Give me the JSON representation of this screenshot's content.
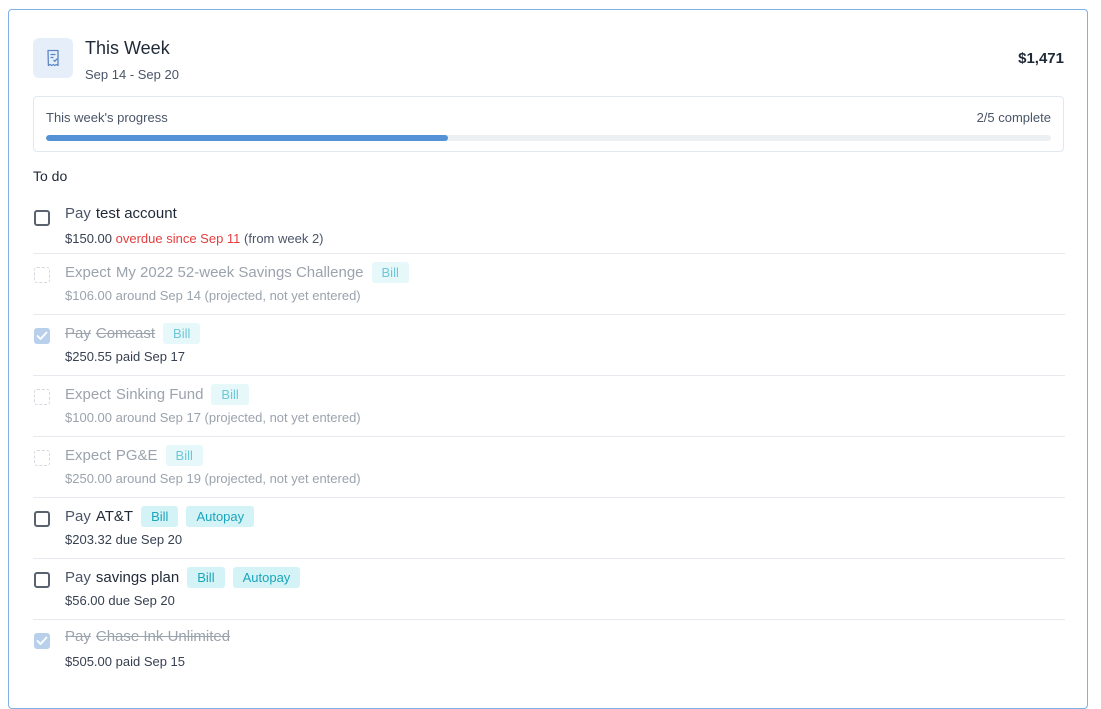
{
  "header": {
    "title": "This Week",
    "date_range": "Sep 14 - Sep 20",
    "total": "$1,471",
    "icon": "receipt-icon"
  },
  "progress": {
    "label": "This week's progress",
    "count_text": "2/5 complete",
    "completed": 2,
    "total": 5,
    "fill_fraction": 0.4,
    "color": "#5591d6"
  },
  "section": {
    "title": "To do"
  },
  "items": [
    {
      "state": "unchecked",
      "verb": "Pay",
      "name": "test account",
      "tags": [],
      "amount": "$150.00",
      "status": "overdue since Sep 11",
      "note": "(from week 2)"
    },
    {
      "state": "projected",
      "verb": "Expect",
      "name": "My 2022 52-week Savings Challenge",
      "tags": [
        "Bill"
      ],
      "amount": "$106.00",
      "status": "around Sep 14",
      "note": "(projected, not yet entered)"
    },
    {
      "state": "done",
      "verb": "Pay",
      "name": "Comcast",
      "tags": [
        "Bill"
      ],
      "amount": "$250.55",
      "status": "paid Sep 17",
      "note": ""
    },
    {
      "state": "projected",
      "verb": "Expect",
      "name": "Sinking Fund",
      "tags": [
        "Bill"
      ],
      "amount": "$100.00",
      "status": "around Sep 17",
      "note": "(projected, not yet entered)"
    },
    {
      "state": "projected",
      "verb": "Expect",
      "name": "PG&E",
      "tags": [
        "Bill"
      ],
      "amount": "$250.00",
      "status": "around Sep 19",
      "note": "(projected, not yet entered)"
    },
    {
      "state": "unchecked",
      "verb": "Pay",
      "name": "AT&T",
      "tags": [
        "Bill",
        "Autopay"
      ],
      "amount": "$203.32",
      "status": "due Sep 20",
      "note": ""
    },
    {
      "state": "unchecked",
      "verb": "Pay",
      "name": "savings plan",
      "tags": [
        "Bill",
        "Autopay"
      ],
      "amount": "$56.00",
      "status": "due Sep 20",
      "note": ""
    },
    {
      "state": "done",
      "verb": "Pay",
      "name": "Chase Ink Unlimited",
      "tags": [],
      "amount": "$505.00",
      "status": "paid Sep 15",
      "note": ""
    }
  ],
  "colors": {
    "border": "#7fb0e6",
    "overdue": "#e53e3e",
    "tag_bg": "#d4f3f6",
    "tag_text": "#1ba5bb",
    "checked_box": "#b8d0ec"
  }
}
